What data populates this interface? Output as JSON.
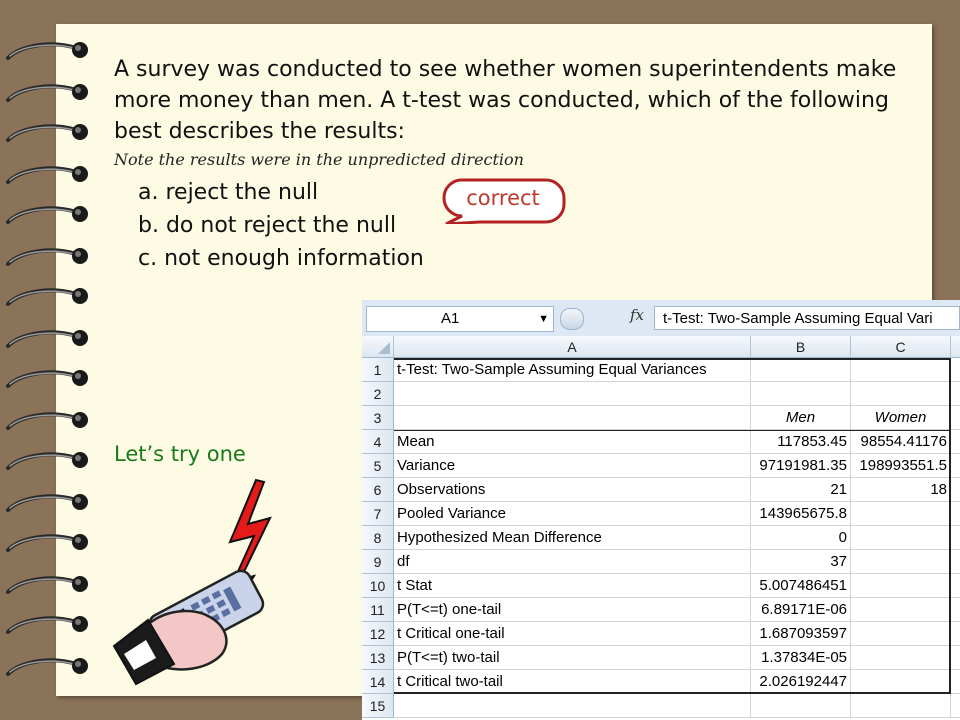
{
  "slide": {
    "question": "A survey was conducted to see whether women superintendents make more money than men. A t-test was conducted, which of the following best describes the results:",
    "note": "Note the results were in the unpredicted direction",
    "options": [
      "a. reject the null",
      "b. do not reject the null",
      "c. not enough information"
    ],
    "callout": "correct",
    "lets_try": "Let’s try one"
  },
  "excel": {
    "name_box": "A1",
    "fx_label": "fx",
    "formula": "t-Test: Two-Sample Assuming Equal Vari",
    "columns": [
      "A",
      "B",
      "C"
    ],
    "rows": [
      {
        "num": "1",
        "a": "t-Test: Two-Sample Assuming Equal Variances",
        "b": "",
        "c": ""
      },
      {
        "num": "2",
        "a": "",
        "b": "",
        "c": ""
      },
      {
        "num": "3",
        "a": "",
        "b": "Men",
        "c": "Women"
      },
      {
        "num": "4",
        "a": "Mean",
        "b": "117853.45",
        "c": "98554.41176"
      },
      {
        "num": "5",
        "a": "Variance",
        "b": "97191981.35",
        "c": "198993551.5"
      },
      {
        "num": "6",
        "a": "Observations",
        "b": "21",
        "c": "18"
      },
      {
        "num": "7",
        "a": "Pooled Variance",
        "b": "143965675.8",
        "c": ""
      },
      {
        "num": "8",
        "a": "Hypothesized Mean Difference",
        "b": "0",
        "c": ""
      },
      {
        "num": "9",
        "a": "df",
        "b": "37",
        "c": ""
      },
      {
        "num": "10",
        "a": "t Stat",
        "b": "5.007486451",
        "c": ""
      },
      {
        "num": "11",
        "a": "P(T<=t) one-tail",
        "b": "6.89171E-06",
        "c": ""
      },
      {
        "num": "12",
        "a": "t Critical one-tail",
        "b": "1.687093597",
        "c": ""
      },
      {
        "num": "13",
        "a": "P(T<=t) two-tail",
        "b": "1.37834E-05",
        "c": ""
      },
      {
        "num": "14",
        "a": "t Critical two-tail",
        "b": "2.026192447",
        "c": ""
      },
      {
        "num": "15",
        "a": "",
        "b": "",
        "c": ""
      }
    ]
  }
}
